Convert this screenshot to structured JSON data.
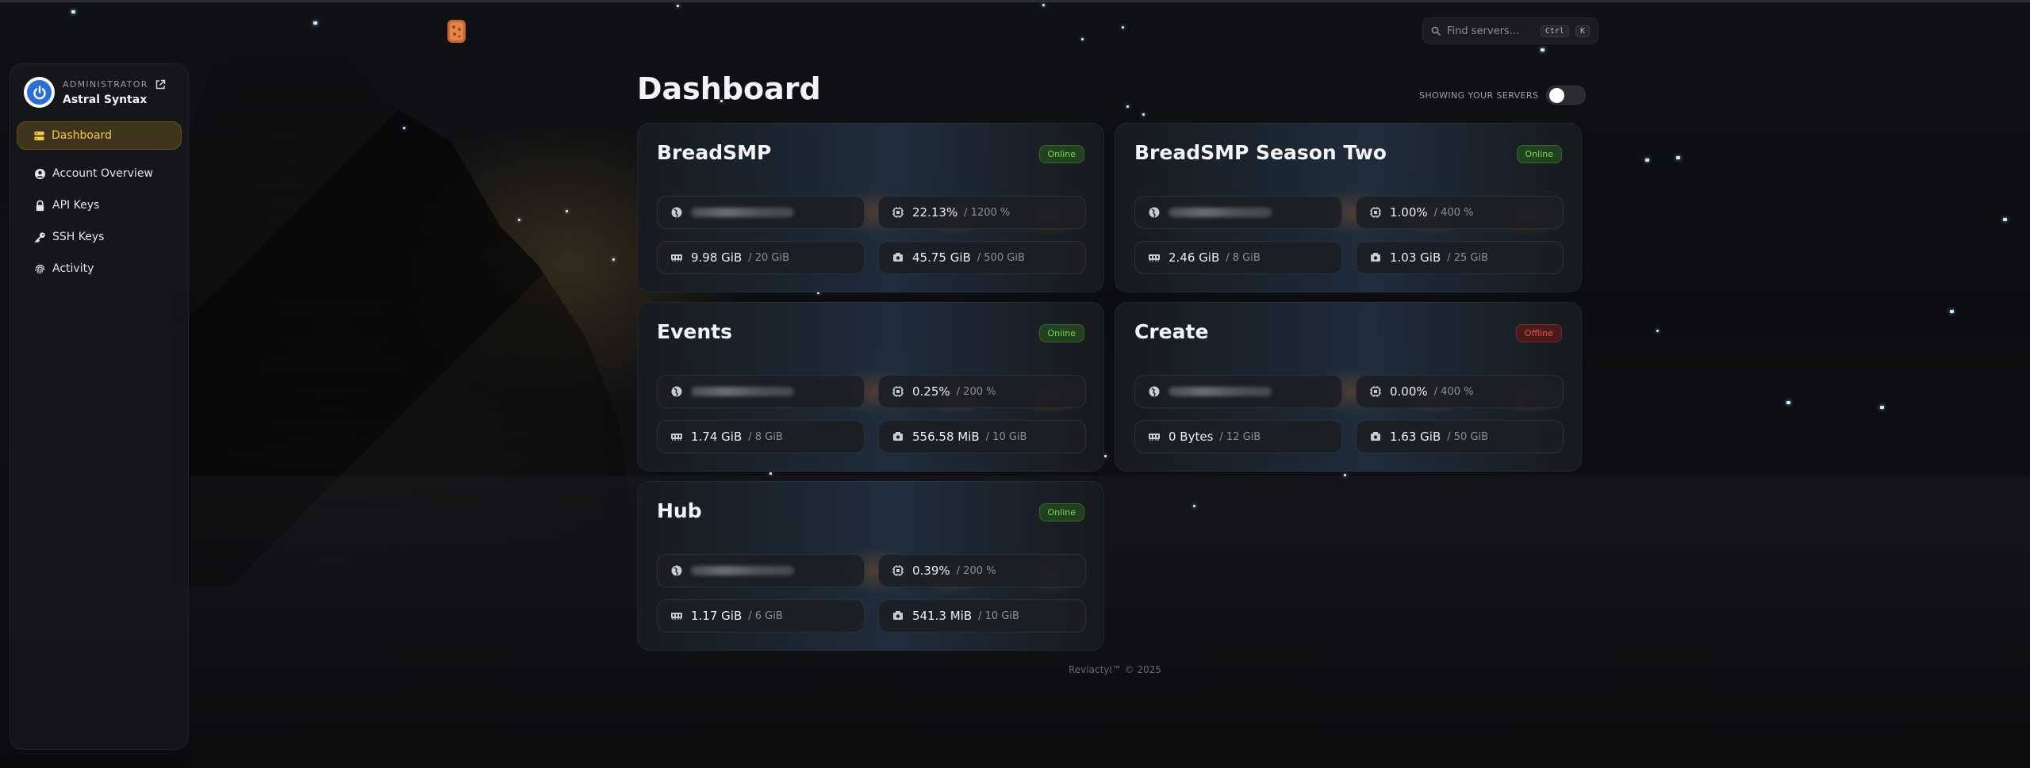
{
  "sidebar": {
    "user": {
      "role": "ADMINISTRATOR",
      "name": "Astral Syntax"
    },
    "items": [
      {
        "label": "Dashboard",
        "icon": "server-icon",
        "active": true
      },
      {
        "label": "Account Overview",
        "icon": "user-circle-icon"
      },
      {
        "label": "API Keys",
        "icon": "lock-icon"
      },
      {
        "label": "SSH Keys",
        "icon": "key-icon"
      },
      {
        "label": "Activity",
        "icon": "fingerprint-icon"
      }
    ]
  },
  "search": {
    "placeholder": "Find servers...",
    "shortcut_mod": "Ctrl",
    "shortcut_key": "K"
  },
  "main": {
    "title": "Dashboard",
    "toggle_label": "SHOWING YOUR SERVERS",
    "toggle_on": false
  },
  "servers": [
    {
      "name": "BreadSMP",
      "status": "Online",
      "cpu": "22.13%",
      "cpu_max": "/ 1200 %",
      "memory": "9.98 GiB",
      "memory_max": "/ 20 GiB",
      "disk": "45.75 GiB",
      "disk_max": "/ 500 GiB"
    },
    {
      "name": "BreadSMP Season Two",
      "status": "Online",
      "cpu": "1.00%",
      "cpu_max": "/ 400 %",
      "memory": "2.46 GiB",
      "memory_max": "/ 8 GiB",
      "disk": "1.03 GiB",
      "disk_max": "/ 25 GiB"
    },
    {
      "name": "Events",
      "status": "Online",
      "cpu": "0.25%",
      "cpu_max": "/ 200 %",
      "memory": "1.74 GiB",
      "memory_max": "/ 8 GiB",
      "disk": "556.58 MiB",
      "disk_max": "/ 10 GiB"
    },
    {
      "name": "Create",
      "status": "Offline",
      "cpu": "0.00%",
      "cpu_max": "/ 400 %",
      "memory": "0 Bytes",
      "memory_max": "/ 12 GiB",
      "disk": "1.63 GiB",
      "disk_max": "/ 50 GiB"
    },
    {
      "name": "Hub",
      "status": "Online",
      "cpu": "0.39%",
      "cpu_max": "/ 200 %",
      "memory": "1.17 GiB",
      "memory_max": "/ 6 GiB",
      "disk": "541.3 MiB",
      "disk_max": "/ 10 GiB"
    }
  ],
  "footer": {
    "text": "Reviactyl™ © 2025"
  },
  "colors": {
    "accent": "#f5c84c",
    "online": "#7fd35a",
    "offline": "#e05a5a",
    "avatar": "#2b6ed6"
  }
}
